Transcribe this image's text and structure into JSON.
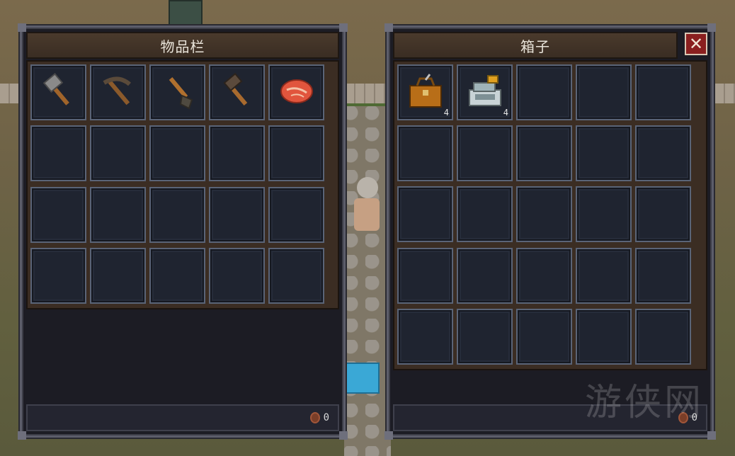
{
  "inventory": {
    "title": "物品栏",
    "coins": "0",
    "rows": 4,
    "cols": 5,
    "items": [
      {
        "icon": "axe-icon",
        "count": ""
      },
      {
        "icon": "pickaxe-icon",
        "count": ""
      },
      {
        "icon": "shovel-icon",
        "count": ""
      },
      {
        "icon": "hammer-icon",
        "count": ""
      },
      {
        "icon": "meat-icon",
        "count": ""
      }
    ]
  },
  "chest": {
    "title": "箱子",
    "close_label": "✕",
    "coins": "0",
    "rows": 5,
    "cols": 5,
    "items": [
      {
        "icon": "toolbox-icon",
        "count": "4"
      },
      {
        "icon": "cash-register-icon",
        "count": "4"
      }
    ]
  },
  "watermark": "游侠网"
}
